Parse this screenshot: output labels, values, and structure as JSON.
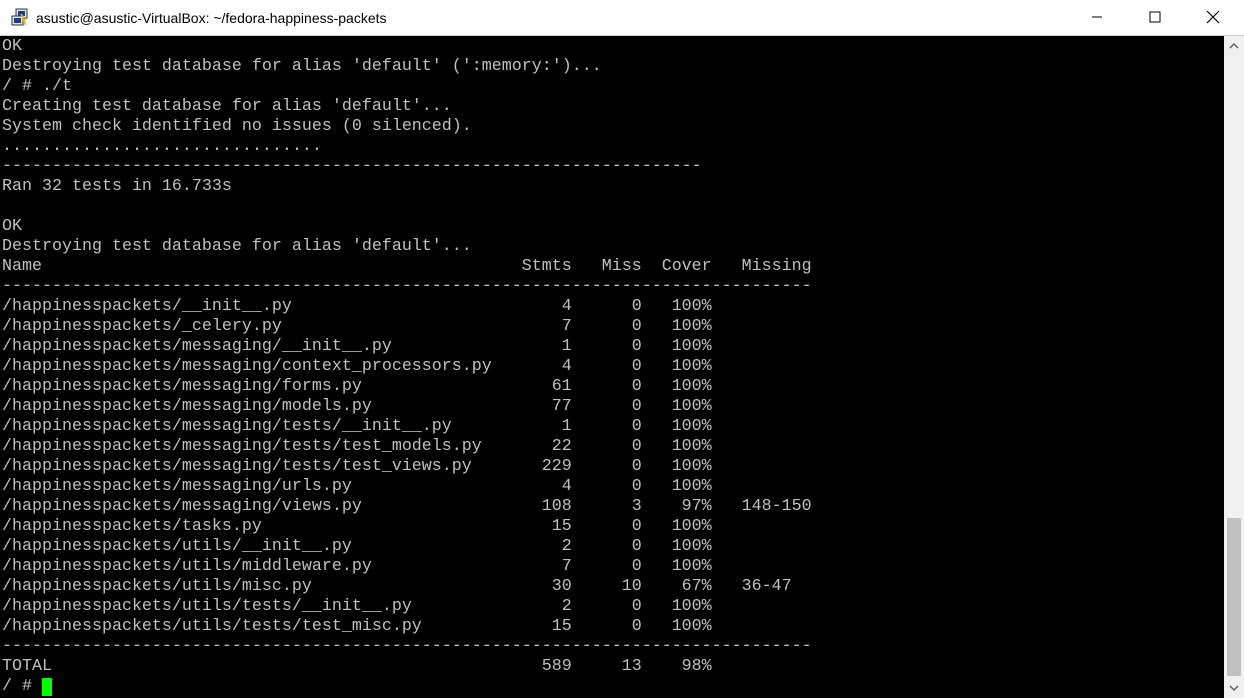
{
  "window": {
    "title": "asustic@asustic-VirtualBox: ~/fedora-happiness-packets",
    "icon": "putty-terminal-icon",
    "controls": [
      "minimize",
      "maximize",
      "close"
    ]
  },
  "terminal": {
    "lines": [
      "OK",
      "Destroying test database for alias 'default' (':memory:')...",
      "/ # ./t",
      "Creating test database for alias 'default'...",
      "System check identified no issues (0 silenced).",
      "................................",
      "----------------------------------------------------------------------",
      "Ran 32 tests in 16.733s",
      "",
      "OK",
      "Destroying test database for alias 'default'...",
      "Name                                                Stmts   Miss  Cover   Missing",
      "---------------------------------------------------------------------------------",
      "/happinesspackets/__init__.py                           4      0   100%",
      "/happinesspackets/_celery.py                            7      0   100%",
      "/happinesspackets/messaging/__init__.py                 1      0   100%",
      "/happinesspackets/messaging/context_processors.py       4      0   100%",
      "/happinesspackets/messaging/forms.py                   61      0   100%",
      "/happinesspackets/messaging/models.py                  77      0   100%",
      "/happinesspackets/messaging/tests/__init__.py           1      0   100%",
      "/happinesspackets/messaging/tests/test_models.py       22      0   100%",
      "/happinesspackets/messaging/tests/test_views.py       229      0   100%",
      "/happinesspackets/messaging/urls.py                     4      0   100%",
      "/happinesspackets/messaging/views.py                  108      3    97%   148-150",
      "/happinesspackets/tasks.py                             15      0   100%",
      "/happinesspackets/utils/__init__.py                     2      0   100%",
      "/happinesspackets/utils/middleware.py                   7      0   100%",
      "/happinesspackets/utils/misc.py                        30     10    67%   36-47",
      "/happinesspackets/utils/tests/__init__.py               2      0   100%",
      "/happinesspackets/utils/tests/test_misc.py             15      0   100%",
      "---------------------------------------------------------------------------------",
      "TOTAL                                                 589     13    98%",
      "/ # "
    ],
    "cursor_color": "#00ff00",
    "text_color": "#c0c0c0",
    "background": "#000000"
  }
}
